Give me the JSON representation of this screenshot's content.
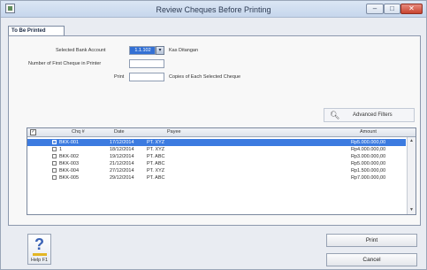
{
  "window": {
    "title": "Review Cheques Before Printing",
    "controls": {
      "minimize": "–",
      "maximize": "□",
      "close": "✕"
    }
  },
  "tab": {
    "label": "To Be Printed"
  },
  "form": {
    "bank_account_label": "Selected Bank Account",
    "bank_account_value": "1.1.102",
    "bank_account_name": "Kas Ditangan",
    "first_cheque_label": "Number of First Cheque in Printer",
    "first_cheque_value": "",
    "print_label": "Print",
    "print_value": "",
    "copies_label": "Copies of Each Selected Cheque"
  },
  "filter_button": {
    "icon": "magnifier-icon",
    "label": "Advanced Filters"
  },
  "table": {
    "columns": [
      "Chq #",
      "Date",
      "Payee",
      "Amount"
    ],
    "rows": [
      {
        "chq": "BKK-001",
        "date": "17/12/2014",
        "payee": "PT. XYZ",
        "amount": "Rp5.000.000,00",
        "selected": true
      },
      {
        "chq": "1",
        "date": "18/12/2014",
        "payee": "PT. XYZ",
        "amount": "Rp4.000.000,00",
        "selected": false
      },
      {
        "chq": "BKK-002",
        "date": "19/12/2014",
        "payee": "PT. ABC",
        "amount": "Rp3.000.000,00",
        "selected": false
      },
      {
        "chq": "BKK-003",
        "date": "21/12/2014",
        "payee": "PT. ABC",
        "amount": "Rp5.000.000,00",
        "selected": false
      },
      {
        "chq": "BKK-004",
        "date": "27/12/2014",
        "payee": "PT. XYZ",
        "amount": "Rp1.500.000,00",
        "selected": false
      },
      {
        "chq": "BKK-005",
        "date": "29/12/2014",
        "payee": "PT. ABC",
        "amount": "Rp7.000.000,00",
        "selected": false
      }
    ]
  },
  "help": {
    "label": "Help F1",
    "icon": "help-question-icon"
  },
  "buttons": {
    "print": "Print",
    "cancel": "Cancel"
  },
  "colors": {
    "selection": "#3c7be0",
    "accent": "#3370d4"
  }
}
